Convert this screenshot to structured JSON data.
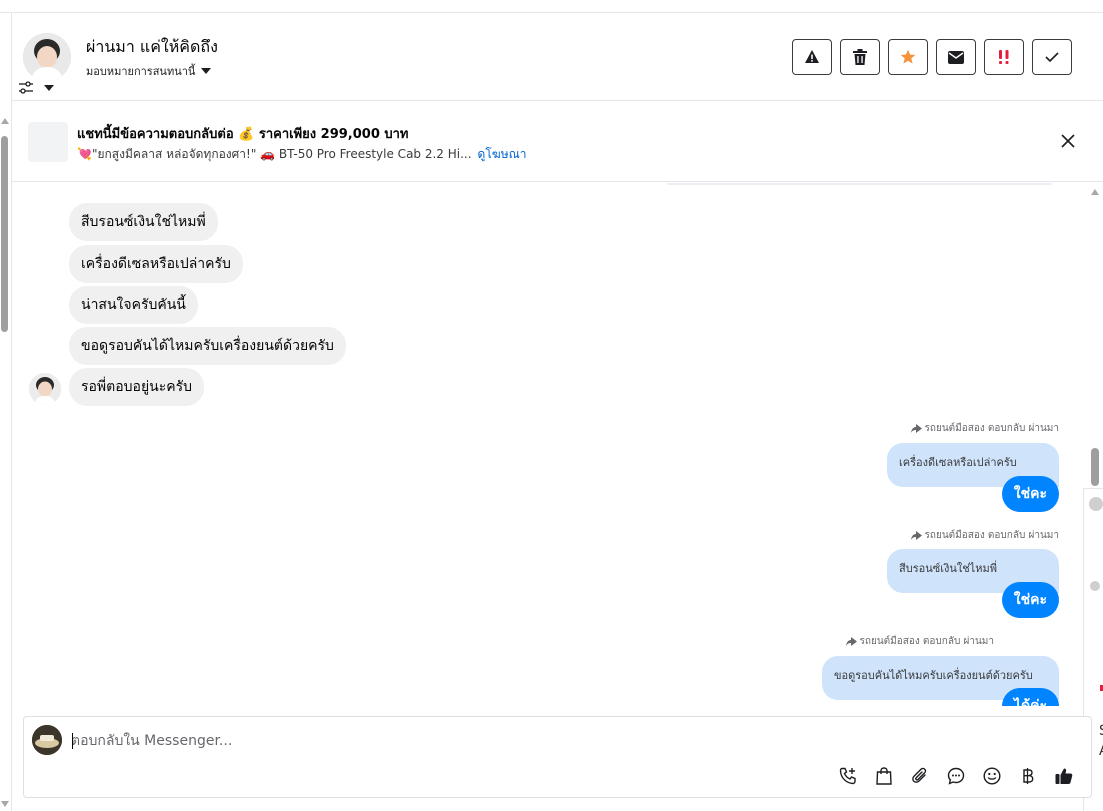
{
  "header": {
    "name": "ผ่านมา แค่ให้คิดถึง",
    "assign_label": "มอบหมายการสนทนานี้",
    "actions": [
      {
        "name": "report-icon"
      },
      {
        "name": "trash-icon"
      },
      {
        "name": "star-icon"
      },
      {
        "name": "envelope-icon"
      },
      {
        "name": "follow-up-icon"
      },
      {
        "name": "check-icon"
      }
    ]
  },
  "ad": {
    "title": "แชทนี้มีข้อความตอบกลับต่อ 💰 ราคาเพียง 299,000 บาท",
    "subtitle": "💘\"ยกสูงมีคลาส หล่อจัดทุกองศา!\" 🚗 BT-50 Pro Freestyle Cab 2.2 Hi...",
    "link": "ดูโฆษณา"
  },
  "messages_in": [
    "สีบรอนซ์เงินใช่ไหมพี่",
    "เครื่องดีเซลหรือเปล่าครับ",
    "น่าสนใจครับคันนี้",
    "ขอดูรอบคันได้ไหมครับเครื่องยนต์ด้วยครับ",
    "รอพี่ตอบอยู่นะครับ"
  ],
  "replies": [
    {
      "meta": "รถยนต์มือสอง ตอบกลับ ผ่านมา",
      "quoted": "เครื่องดีเซลหรือเปล่าครับ",
      "text": "ใช่คะ"
    },
    {
      "meta": "รถยนต์มือสอง ตอบกลับ ผ่านมา",
      "quoted": "สีบรอนซ์เงินใช่ไหมพี่",
      "text": "ใช่คะ"
    },
    {
      "meta": "รถยนต์มือสอง ตอบกลับ ผ่านมา",
      "quoted": "ขอดูรอบคันได้ไหมครับเครื่องยนต์ด้วยครับ",
      "text": "ได้ค่ะ"
    }
  ],
  "composer": {
    "placeholder": "ตอบกลับใน Messenger...",
    "tools": [
      "call-icon",
      "shopping-bag-icon",
      "attach-icon",
      "saved-reply-icon",
      "emoji-icon",
      "baht-icon",
      "thumbs-up-icon"
    ]
  },
  "side_fragment": {
    "line1": "S",
    "line2": "A"
  }
}
